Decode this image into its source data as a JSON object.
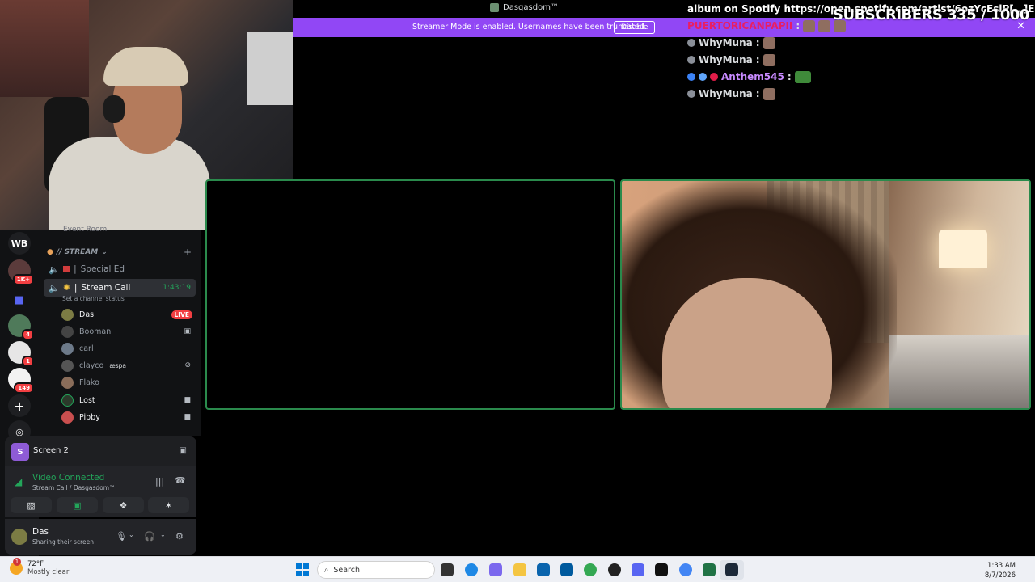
{
  "window": {
    "title": "Dasgasdom™"
  },
  "streamer_mode": {
    "message": "Streamer Mode is enabled. Usernames have been truncated.",
    "disable_label": "Disable",
    "close_glyph": "✕",
    "bg_color": "#9147f5"
  },
  "chat_overlay": {
    "ticker": "album on Spotify https://open.spotify.com/artist/6ozYcEsiP[…]Eu.BJv5mIr",
    "subscribers": "SUBSCRIBERS 335 / 1000",
    "messages": [
      {
        "user": "PUERTORICANPAPII",
        "sep": ":",
        "color": "#e91e63"
      },
      {
        "user": "WhyMuna",
        "sep": ":",
        "color": "#dbdee1"
      },
      {
        "user": "WhyMuna",
        "sep": ":",
        "color": "#dbdee1"
      },
      {
        "user": "Anthem545",
        "sep": ":",
        "color": "#c88aff"
      },
      {
        "user": "WhyMuna",
        "sep": ":",
        "color": "#dbdee1"
      }
    ]
  },
  "guilds": {
    "wb_label": "WB",
    "badges": [
      "1K+",
      "4",
      "1",
      "149"
    ],
    "add_glyph": "+",
    "discover_glyph": "◎"
  },
  "channel_list": {
    "top_cut_label": "Event Room",
    "category": "// STREAM",
    "channels": [
      {
        "name": "Special Ed",
        "prefix": "|"
      },
      {
        "name": "Stream Call",
        "prefix": "|",
        "timer": "1:43:19"
      }
    ],
    "status_hint": "Set a channel status",
    "voice_users": [
      {
        "name": "Das",
        "badge": "LIVE"
      },
      {
        "name": "Booman"
      },
      {
        "name": "carl"
      },
      {
        "name": "clayco",
        "tag": "æspa"
      },
      {
        "name": "Flako"
      },
      {
        "name": "Lost"
      },
      {
        "name": "Pibby"
      }
    ]
  },
  "screen_panel": {
    "label": "Screen 2",
    "initial": "S"
  },
  "voice_panel": {
    "status": "Video Connected",
    "sub": "Stream Call / Dasgasdom™"
  },
  "user_panel": {
    "name": "Das",
    "status": "Sharing their screen"
  },
  "taskbar": {
    "temp": "72°F",
    "condition": "Mostly clear",
    "weather_badge": "1",
    "search_placeholder": "Search",
    "time": "1:33 AM",
    "date": "8/7/2026"
  }
}
